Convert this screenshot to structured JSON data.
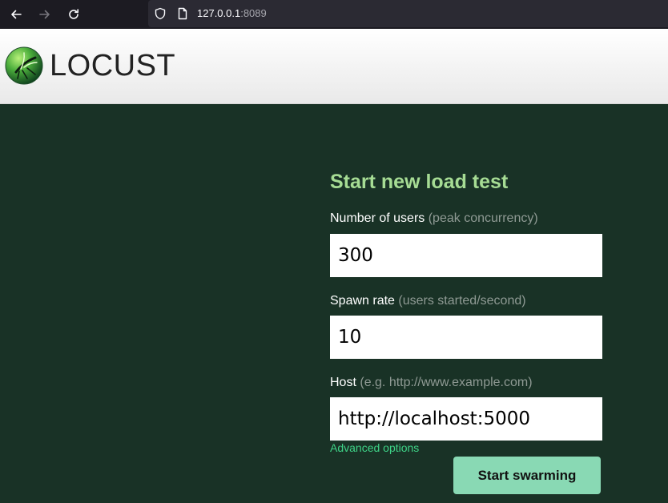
{
  "browser": {
    "url_host": "127.0.0.1",
    "url_port": ":8089"
  },
  "app": {
    "logo_text": "LOCUST"
  },
  "form": {
    "title": "Start new load test",
    "fields": [
      {
        "label": "Number of users",
        "hint": "(peak concurrency)",
        "value": "300"
      },
      {
        "label": "Spawn rate",
        "hint": "(users started/second)",
        "value": "10"
      },
      {
        "label": "Host",
        "hint": "(e.g. http://www.example.com)",
        "value": "http://localhost:5000"
      }
    ],
    "advanced_link": "Advanced options",
    "submit_label": "Start swarming"
  },
  "colors": {
    "page_background": "#193226",
    "title_green": "#a6dc94",
    "link_green": "#3ed387",
    "button_green": "#89d9b4"
  }
}
